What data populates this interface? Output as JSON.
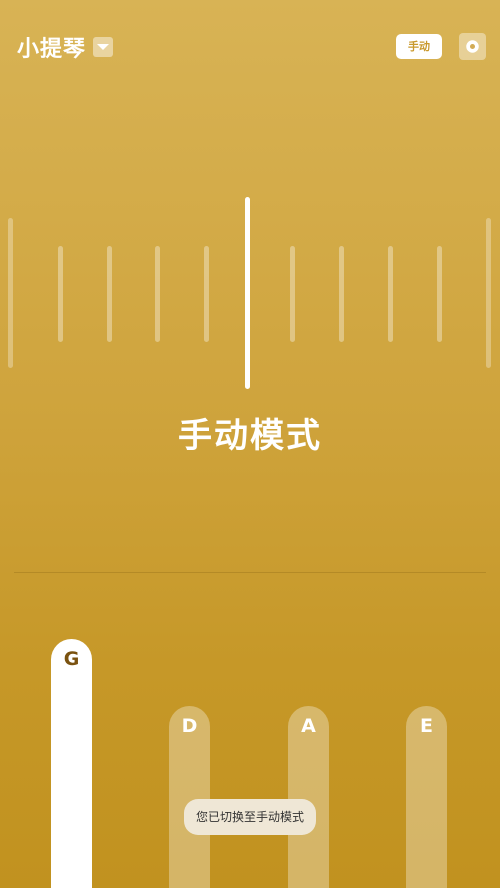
{
  "header": {
    "instrument": "小提琴",
    "mode_button": "手动",
    "icons": {
      "dropdown": "caret-down-icon",
      "settings": "gear-icon"
    }
  },
  "tuner": {
    "mode_title": "手动模式"
  },
  "strings": [
    {
      "note": "G",
      "active": true
    },
    {
      "note": "D",
      "active": false
    },
    {
      "note": "A",
      "active": false
    },
    {
      "note": "E",
      "active": false
    }
  ],
  "toast": "您已切换至手动模式",
  "colors": {
    "background_top": "#d8b355",
    "background_bottom": "#c1921f",
    "accent_text": "#c9992c",
    "active_note_text": "#7a5210",
    "needle": "#ffffff"
  }
}
